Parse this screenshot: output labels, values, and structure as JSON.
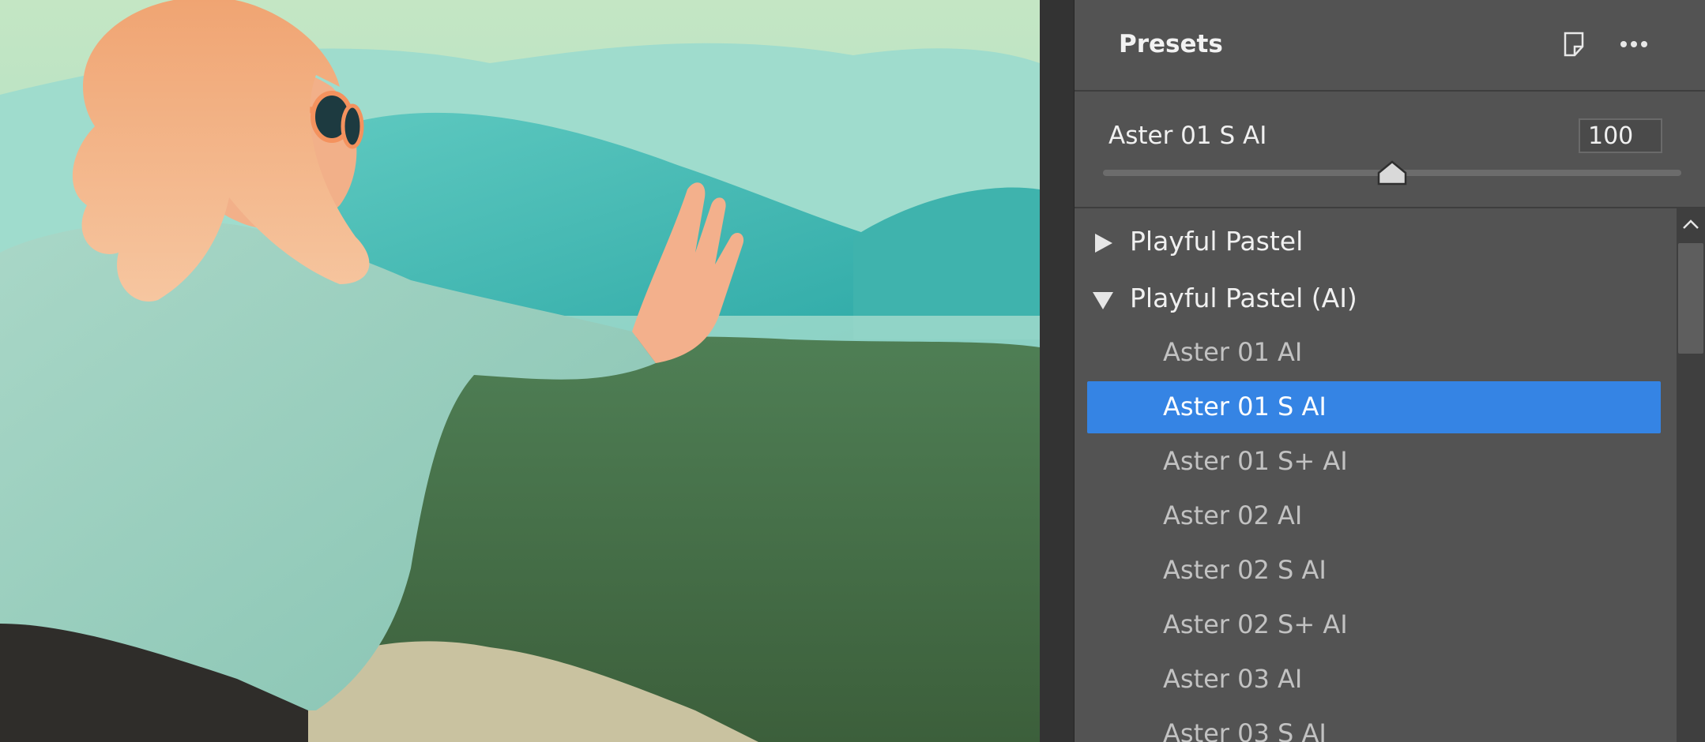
{
  "panel": {
    "title": "Presets",
    "icons": [
      "note-icon",
      "more-icon"
    ]
  },
  "strength": {
    "preset_name": "Aster 01 S AI",
    "value": "100",
    "slider_level_fraction": 0.5
  },
  "groups": [
    {
      "label": "Playful Pastel",
      "expanded": false
    },
    {
      "label": "Playful Pastel (AI)",
      "expanded": true
    }
  ],
  "items": [
    {
      "label": "Aster 01 AI",
      "selected": false
    },
    {
      "label": "Aster 01 S AI",
      "selected": true
    },
    {
      "label": "Aster 01 S+ AI",
      "selected": false
    },
    {
      "label": "Aster 02 AI",
      "selected": false
    },
    {
      "label": "Aster 02 S AI",
      "selected": false
    },
    {
      "label": "Aster 02 S+ AI",
      "selected": false
    },
    {
      "label": "Aster 03 AI",
      "selected": false
    },
    {
      "label": "Aster 03 S AI",
      "selected": false
    }
  ],
  "colors": {
    "panel_bg": "#535353",
    "selection": "#3584e4",
    "text_primary": "#f0f0f0",
    "text_secondary": "#c2c2c2"
  }
}
